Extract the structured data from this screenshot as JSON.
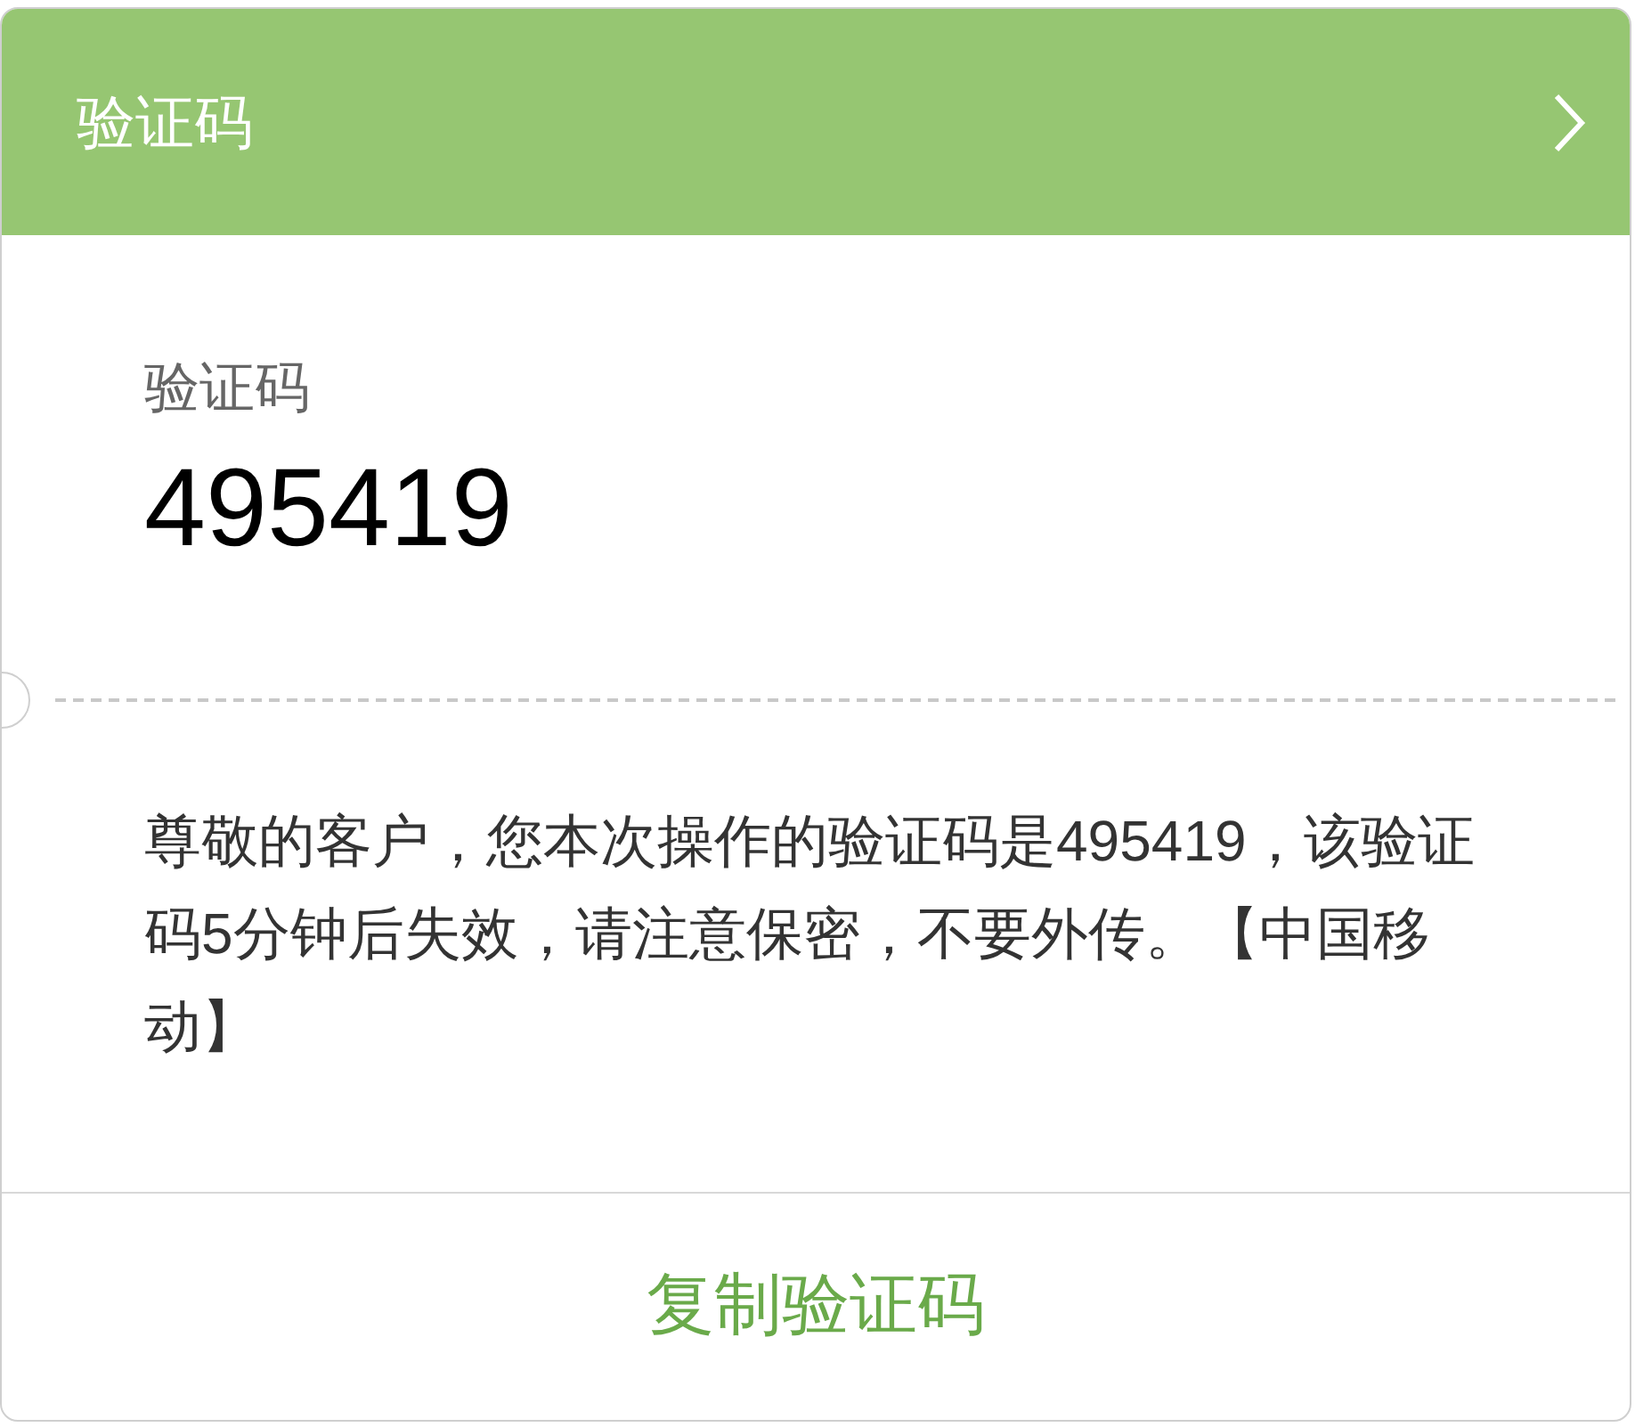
{
  "header": {
    "title": "验证码"
  },
  "code_label": "验证码",
  "code": "495419",
  "message": "尊敬的客户，您本次操作的验证码是495419，该验证码5分钟后失效，请注意保密，不要外传。【中国移动】",
  "copy_button": "复制验证码"
}
